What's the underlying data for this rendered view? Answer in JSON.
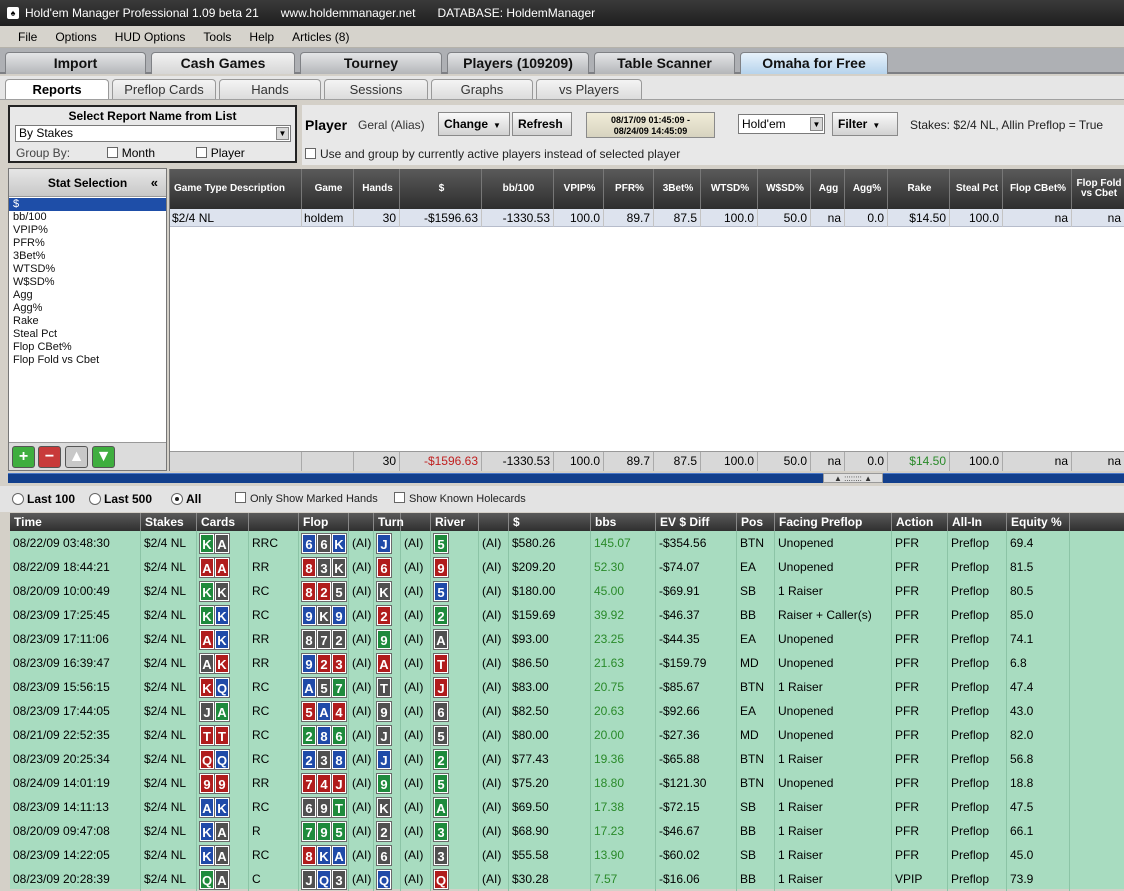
{
  "titlebar": {
    "app_title": "Hold'em Manager Professional 1.09 beta 21",
    "website": "www.holdemmanager.net",
    "database": "DATABASE: HoldemManager"
  },
  "menu": [
    "File",
    "Options",
    "HUD Options",
    "Tools",
    "Help",
    "Articles (8)"
  ],
  "main_tabs": [
    "Import",
    "Cash Games",
    "Tourney",
    "Players (109209)",
    "Table Scanner",
    "Omaha for Free"
  ],
  "sub_tabs": [
    "Reports",
    "Preflop Cards",
    "Hands",
    "Sessions",
    "Graphs",
    "vs Players"
  ],
  "report_select": {
    "label": "Select Report Name from List",
    "value": "By Stakes",
    "group_by_label": "Group By:",
    "group_month": "Month",
    "group_player": "Player"
  },
  "player_bar": {
    "label": "Player",
    "name": "Geral (Alias)",
    "change": "Change",
    "refresh": "Refresh",
    "date_from": "08/17/09 01:45:09 -",
    "date_to": "08/24/09 14:45:09",
    "game_type": "Hold'em",
    "filter": "Filter",
    "stakes_summary": "Stakes: $2/4 NL, Allin Preflop = True",
    "use_group_text": "Use and group by currently active players instead of selected player"
  },
  "stat_selection": {
    "title": "Stat Selection",
    "collapse": "«",
    "items": [
      "$",
      "bb/100",
      "VPIP%",
      "PFR%",
      "3Bet%",
      "WTSD%",
      "W$SD%",
      "Agg",
      "Agg%",
      "Rake",
      "Steal Pct",
      "Flop CBet%",
      "Flop Fold vs Cbet"
    ],
    "selected_index": 0
  },
  "report_grid": {
    "columns": [
      "Game Type Description",
      "Game",
      "Hands",
      "$",
      "bb/100",
      "VPIP%",
      "PFR%",
      "3Bet%",
      "WTSD%",
      "W$SD%",
      "Agg",
      "Agg%",
      "Rake",
      "Steal Pct",
      "Flop CBet%",
      "Flop Fold vs Cbet"
    ],
    "rows": [
      [
        "$2/4 NL",
        "holdem",
        "30",
        "-$1596.63",
        "-1330.53",
        "100.0",
        "89.7",
        "87.5",
        "100.0",
        "50.0",
        "na",
        "0.0",
        "$14.50",
        "100.0",
        "na",
        "na"
      ]
    ],
    "totals": [
      "",
      "",
      "30",
      "-$1596.63",
      "-1330.53",
      "100.0",
      "89.7",
      "87.5",
      "100.0",
      "50.0",
      "na",
      "0.0",
      "$14.50",
      "100.0",
      "na",
      "na"
    ]
  },
  "hand_filters": {
    "last100": "Last 100",
    "last500": "Last 500",
    "all": "All",
    "marked": "Only Show Marked Hands",
    "holecards": "Show Known Holecards",
    "selected": "All"
  },
  "hands_grid": {
    "columns": [
      "Time",
      "Stakes",
      "Cards",
      "",
      "Flop",
      "",
      "Turn",
      "",
      "River",
      "",
      "$",
      "bbs",
      "EV $ Diff",
      "Pos",
      "Facing Preflop",
      "Action",
      "All-In",
      "Equity %"
    ],
    "rows": [
      {
        "time": "08/22/09 03:48:30",
        "stakes": "$2/4 NL",
        "cards": [
          [
            "K",
            "c"
          ],
          [
            "A",
            "s"
          ]
        ],
        "pf": "RRC",
        "flop": [
          [
            "6",
            "d"
          ],
          [
            "6",
            "s"
          ],
          [
            "K",
            "d"
          ]
        ],
        "fa": "(AI)",
        "turn": [
          [
            "J",
            "d"
          ]
        ],
        "ta": "(AI)",
        "river": [
          [
            "5",
            "c"
          ]
        ],
        "ra": "(AI)",
        "won": "$580.26",
        "bbs": "145.07",
        "ev": "-$354.56",
        "pos": "BTN",
        "facing": "Unopened",
        "action": "PFR",
        "allin": "Preflop",
        "equity": "69.4"
      },
      {
        "time": "08/22/09 18:44:21",
        "stakes": "$2/4 NL",
        "cards": [
          [
            "A",
            "h"
          ],
          [
            "A",
            "h"
          ]
        ],
        "pf": "RR",
        "flop": [
          [
            "8",
            "h"
          ],
          [
            "3",
            "s"
          ],
          [
            "K",
            "s"
          ]
        ],
        "fa": "(AI)",
        "turn": [
          [
            "6",
            "h"
          ]
        ],
        "ta": "(AI)",
        "river": [
          [
            "9",
            "h"
          ]
        ],
        "ra": "(AI)",
        "won": "$209.20",
        "bbs": "52.30",
        "ev": "-$74.07",
        "pos": "EA",
        "facing": "Unopened",
        "action": "PFR",
        "allin": "Preflop",
        "equity": "81.5"
      },
      {
        "time": "08/20/09 10:00:49",
        "stakes": "$2/4 NL",
        "cards": [
          [
            "K",
            "c"
          ],
          [
            "K",
            "s"
          ]
        ],
        "pf": "RC",
        "flop": [
          [
            "8",
            "h"
          ],
          [
            "2",
            "h"
          ],
          [
            "5",
            "s"
          ]
        ],
        "fa": "(AI)",
        "turn": [
          [
            "K",
            "s"
          ]
        ],
        "ta": "(AI)",
        "river": [
          [
            "5",
            "d"
          ]
        ],
        "ra": "(AI)",
        "won": "$180.00",
        "bbs": "45.00",
        "ev": "-$69.91",
        "pos": "SB",
        "facing": "1 Raiser",
        "action": "PFR",
        "allin": "Preflop",
        "equity": "80.5"
      },
      {
        "time": "08/23/09 17:25:45",
        "stakes": "$2/4 NL",
        "cards": [
          [
            "K",
            "c"
          ],
          [
            "K",
            "d"
          ]
        ],
        "pf": "RC",
        "flop": [
          [
            "9",
            "d"
          ],
          [
            "K",
            "s"
          ],
          [
            "9",
            "d"
          ]
        ],
        "fa": "(AI)",
        "turn": [
          [
            "2",
            "h"
          ]
        ],
        "ta": "(AI)",
        "river": [
          [
            "2",
            "c"
          ]
        ],
        "ra": "(AI)",
        "won": "$159.69",
        "bbs": "39.92",
        "ev": "-$46.37",
        "pos": "BB",
        "facing": "Raiser + Caller(s)",
        "action": "PFR",
        "allin": "Preflop",
        "equity": "85.0"
      },
      {
        "time": "08/23/09 17:11:06",
        "stakes": "$2/4 NL",
        "cards": [
          [
            "A",
            "h"
          ],
          [
            "K",
            "d"
          ]
        ],
        "pf": "RR",
        "flop": [
          [
            "8",
            "s"
          ],
          [
            "7",
            "s"
          ],
          [
            "2",
            "s"
          ]
        ],
        "fa": "(AI)",
        "turn": [
          [
            "9",
            "c"
          ]
        ],
        "ta": "(AI)",
        "river": [
          [
            "A",
            "s"
          ]
        ],
        "ra": "(AI)",
        "won": "$93.00",
        "bbs": "23.25",
        "ev": "-$44.35",
        "pos": "EA",
        "facing": "Unopened",
        "action": "PFR",
        "allin": "Preflop",
        "equity": "74.1"
      },
      {
        "time": "08/23/09 16:39:47",
        "stakes": "$2/4 NL",
        "cards": [
          [
            "A",
            "s"
          ],
          [
            "K",
            "h"
          ]
        ],
        "pf": "RR",
        "flop": [
          [
            "9",
            "d"
          ],
          [
            "2",
            "h"
          ],
          [
            "3",
            "h"
          ]
        ],
        "fa": "(AI)",
        "turn": [
          [
            "A",
            "h"
          ]
        ],
        "ta": "(AI)",
        "river": [
          [
            "T",
            "h"
          ]
        ],
        "ra": "(AI)",
        "won": "$86.50",
        "bbs": "21.63",
        "ev": "-$159.79",
        "pos": "MD",
        "facing": "Unopened",
        "action": "PFR",
        "allin": "Preflop",
        "equity": "6.8"
      },
      {
        "time": "08/23/09 15:56:15",
        "stakes": "$2/4 NL",
        "cards": [
          [
            "K",
            "h"
          ],
          [
            "Q",
            "d"
          ]
        ],
        "pf": "RC",
        "flop": [
          [
            "A",
            "d"
          ],
          [
            "5",
            "s"
          ],
          [
            "7",
            "c"
          ]
        ],
        "fa": "(AI)",
        "turn": [
          [
            "T",
            "s"
          ]
        ],
        "ta": "(AI)",
        "river": [
          [
            "J",
            "h"
          ]
        ],
        "ra": "(AI)",
        "won": "$83.00",
        "bbs": "20.75",
        "ev": "-$85.67",
        "pos": "BTN",
        "facing": "1 Raiser",
        "action": "PFR",
        "allin": "Preflop",
        "equity": "47.4"
      },
      {
        "time": "08/23/09 17:44:05",
        "stakes": "$2/4 NL",
        "cards": [
          [
            "J",
            "s"
          ],
          [
            "A",
            "c"
          ]
        ],
        "pf": "RC",
        "flop": [
          [
            "5",
            "h"
          ],
          [
            "A",
            "d"
          ],
          [
            "4",
            "h"
          ]
        ],
        "fa": "(AI)",
        "turn": [
          [
            "9",
            "s"
          ]
        ],
        "ta": "(AI)",
        "river": [
          [
            "6",
            "s"
          ]
        ],
        "ra": "(AI)",
        "won": "$82.50",
        "bbs": "20.63",
        "ev": "-$92.66",
        "pos": "EA",
        "facing": "Unopened",
        "action": "PFR",
        "allin": "Preflop",
        "equity": "43.0"
      },
      {
        "time": "08/21/09 22:52:35",
        "stakes": "$2/4 NL",
        "cards": [
          [
            "T",
            "h"
          ],
          [
            "T",
            "h"
          ]
        ],
        "pf": "RC",
        "flop": [
          [
            "2",
            "c"
          ],
          [
            "8",
            "d"
          ],
          [
            "6",
            "c"
          ]
        ],
        "fa": "(AI)",
        "turn": [
          [
            "J",
            "s"
          ]
        ],
        "ta": "(AI)",
        "river": [
          [
            "5",
            "s"
          ]
        ],
        "ra": "(AI)",
        "won": "$80.00",
        "bbs": "20.00",
        "ev": "-$27.36",
        "pos": "MD",
        "facing": "Unopened",
        "action": "PFR",
        "allin": "Preflop",
        "equity": "82.0"
      },
      {
        "time": "08/23/09 20:25:34",
        "stakes": "$2/4 NL",
        "cards": [
          [
            "Q",
            "h"
          ],
          [
            "Q",
            "d"
          ]
        ],
        "pf": "RC",
        "flop": [
          [
            "2",
            "d"
          ],
          [
            "3",
            "s"
          ],
          [
            "8",
            "d"
          ]
        ],
        "fa": "(AI)",
        "turn": [
          [
            "J",
            "d"
          ]
        ],
        "ta": "(AI)",
        "river": [
          [
            "2",
            "c"
          ]
        ],
        "ra": "(AI)",
        "won": "$77.43",
        "bbs": "19.36",
        "ev": "-$65.88",
        "pos": "BTN",
        "facing": "1 Raiser",
        "action": "PFR",
        "allin": "Preflop",
        "equity": "56.8"
      },
      {
        "time": "08/24/09 14:01:19",
        "stakes": "$2/4 NL",
        "cards": [
          [
            "9",
            "h"
          ],
          [
            "9",
            "h"
          ]
        ],
        "pf": "RR",
        "flop": [
          [
            "7",
            "h"
          ],
          [
            "4",
            "h"
          ],
          [
            "J",
            "h"
          ]
        ],
        "fa": "(AI)",
        "turn": [
          [
            "9",
            "c"
          ]
        ],
        "ta": "(AI)",
        "river": [
          [
            "5",
            "c"
          ]
        ],
        "ra": "(AI)",
        "won": "$75.20",
        "bbs": "18.80",
        "ev": "-$121.30",
        "pos": "BTN",
        "facing": "Unopened",
        "action": "PFR",
        "allin": "Preflop",
        "equity": "18.8"
      },
      {
        "time": "08/23/09 14:11:13",
        "stakes": "$2/4 NL",
        "cards": [
          [
            "A",
            "d"
          ],
          [
            "K",
            "d"
          ]
        ],
        "pf": "RC",
        "flop": [
          [
            "6",
            "s"
          ],
          [
            "9",
            "s"
          ],
          [
            "T",
            "c"
          ]
        ],
        "fa": "(AI)",
        "turn": [
          [
            "K",
            "s"
          ]
        ],
        "ta": "(AI)",
        "river": [
          [
            "A",
            "c"
          ]
        ],
        "ra": "(AI)",
        "won": "$69.50",
        "bbs": "17.38",
        "ev": "-$72.15",
        "pos": "SB",
        "facing": "1 Raiser",
        "action": "PFR",
        "allin": "Preflop",
        "equity": "47.5"
      },
      {
        "time": "08/20/09 09:47:08",
        "stakes": "$2/4 NL",
        "cards": [
          [
            "K",
            "d"
          ],
          [
            "A",
            "s"
          ]
        ],
        "pf": "R",
        "flop": [
          [
            "7",
            "c"
          ],
          [
            "9",
            "c"
          ],
          [
            "5",
            "c"
          ]
        ],
        "fa": "(AI)",
        "turn": [
          [
            "2",
            "s"
          ]
        ],
        "ta": "(AI)",
        "river": [
          [
            "3",
            "c"
          ]
        ],
        "ra": "(AI)",
        "won": "$68.90",
        "bbs": "17.23",
        "ev": "-$46.67",
        "pos": "BB",
        "facing": "1 Raiser",
        "action": "PFR",
        "allin": "Preflop",
        "equity": "66.1"
      },
      {
        "time": "08/23/09 14:22:05",
        "stakes": "$2/4 NL",
        "cards": [
          [
            "K",
            "d"
          ],
          [
            "A",
            "s"
          ]
        ],
        "pf": "RC",
        "flop": [
          [
            "8",
            "h"
          ],
          [
            "K",
            "d"
          ],
          [
            "A",
            "d"
          ]
        ],
        "fa": "(AI)",
        "turn": [
          [
            "6",
            "s"
          ]
        ],
        "ta": "(AI)",
        "river": [
          [
            "3",
            "s"
          ]
        ],
        "ra": "(AI)",
        "won": "$55.58",
        "bbs": "13.90",
        "ev": "-$60.02",
        "pos": "SB",
        "facing": "1 Raiser",
        "action": "PFR",
        "allin": "Preflop",
        "equity": "45.0"
      },
      {
        "time": "08/23/09 20:28:39",
        "stakes": "$2/4 NL",
        "cards": [
          [
            "Q",
            "c"
          ],
          [
            "A",
            "s"
          ]
        ],
        "pf": "C",
        "flop": [
          [
            "J",
            "s"
          ],
          [
            "Q",
            "d"
          ],
          [
            "3",
            "s"
          ]
        ],
        "fa": "(AI)",
        "turn": [
          [
            "Q",
            "d"
          ]
        ],
        "ta": "(AI)",
        "river": [
          [
            "Q",
            "h"
          ]
        ],
        "ra": "(AI)",
        "won": "$30.28",
        "bbs": "7.57",
        "ev": "-$16.06",
        "pos": "BB",
        "facing": "1 Raiser",
        "action": "VPIP",
        "allin": "Preflop",
        "equity": "73.9"
      }
    ]
  },
  "colors": {
    "grid_bg": "#a8dcc0",
    "bbs_green": "#2a8a2a",
    "neg_red": "#c02020",
    "title_bg": "#2a2a2a",
    "splitter": "#123f8c"
  }
}
